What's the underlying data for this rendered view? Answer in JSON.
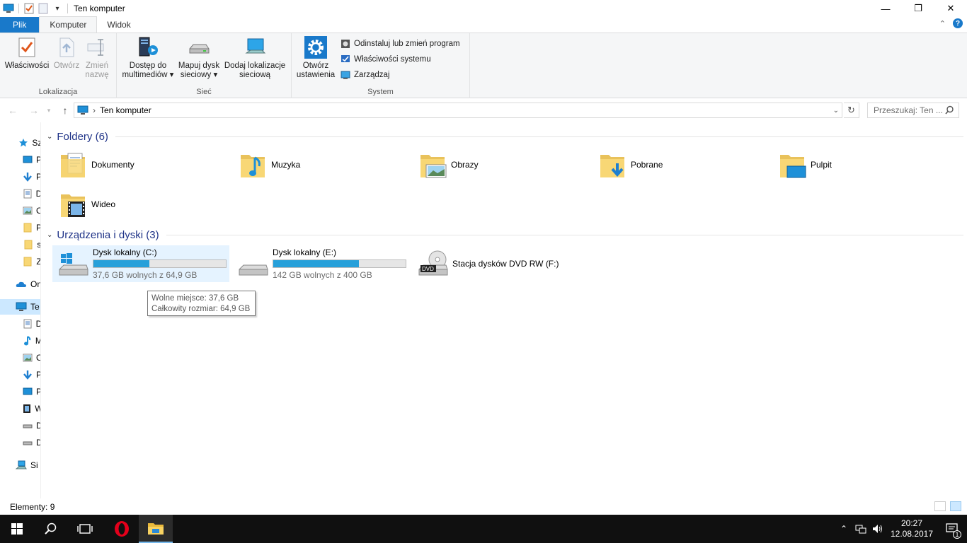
{
  "window": {
    "title": "Ten komputer",
    "minimize": "—",
    "maximize": "❐",
    "close": "✕"
  },
  "ribbon_tabs": [
    {
      "label": "Plik"
    },
    {
      "label": "Komputer"
    },
    {
      "label": "Widok"
    }
  ],
  "ribbon": {
    "location_group": {
      "label": "Lokalizacja",
      "properties": "Właściwości",
      "open": "Otwórz",
      "rename_1": "Zmień",
      "rename_2": "nazwę"
    },
    "network_group": {
      "label": "Sieć",
      "media_1": "Dostęp do",
      "media_2": "multimediów",
      "map_1": "Mapuj dysk",
      "map_2": "sieciowy",
      "add_1": "Dodaj lokalizacje",
      "add_2": "sieciową"
    },
    "system_group": {
      "label": "System",
      "settings_1": "Otwórz",
      "settings_2": "ustawienia",
      "uninstall": "Odinstaluj lub zmień program",
      "sysprops": "Właściwości systemu",
      "manage": "Zarządzaj"
    }
  },
  "address": {
    "path": "Ten komputer",
    "search_placeholder": "Przeszukaj: Ten ..."
  },
  "nav_pane": [
    {
      "icon": "star-icon",
      "label": "Sz"
    },
    {
      "icon": "desktop-icon",
      "label": "P"
    },
    {
      "icon": "download-icon",
      "label": "P"
    },
    {
      "icon": "document-icon",
      "label": "D"
    },
    {
      "icon": "pictures-icon",
      "label": "O"
    },
    {
      "icon": "folder-icon",
      "label": "P"
    },
    {
      "icon": "folder-icon",
      "label": "s"
    },
    {
      "icon": "folder-icon",
      "label": "Z"
    },
    {
      "icon": "onedrive-icon",
      "label": "On"
    },
    {
      "icon": "computer-icon",
      "label": "Te"
    },
    {
      "icon": "document-icon",
      "label": "D"
    },
    {
      "icon": "music-icon",
      "label": "M"
    },
    {
      "icon": "pictures-icon",
      "label": "O"
    },
    {
      "icon": "download-icon",
      "label": "P"
    },
    {
      "icon": "desktop-icon",
      "label": "P"
    },
    {
      "icon": "video-icon",
      "label": "W"
    },
    {
      "icon": "drive-icon",
      "label": "D"
    },
    {
      "icon": "drive-icon",
      "label": "D"
    },
    {
      "icon": "network-icon",
      "label": "Si"
    }
  ],
  "folders_section": {
    "title": "Foldery (6)",
    "items": [
      {
        "label": "Dokumenty",
        "icon": "documents-folder-icon"
      },
      {
        "label": "Muzyka",
        "icon": "music-folder-icon"
      },
      {
        "label": "Obrazy",
        "icon": "pictures-folder-icon"
      },
      {
        "label": "Pobrane",
        "icon": "downloads-folder-icon"
      },
      {
        "label": "Pulpit",
        "icon": "desktop-folder-icon"
      },
      {
        "label": "Wideo",
        "icon": "video-folder-icon"
      }
    ]
  },
  "devices_section": {
    "title": "Urządzenia i dyski (3)",
    "drives": [
      {
        "label": "Dysk lokalny (C:)",
        "free": "37,6 GB wolnych z 64,9 GB",
        "used_fraction": 0.42,
        "icon": "windows-drive-icon"
      },
      {
        "label": "Dysk lokalny (E:)",
        "free": "142 GB wolnych z 400 GB",
        "used_fraction": 0.645,
        "icon": "hard-drive-icon"
      },
      {
        "label": "Stacja dysków DVD RW (F:)",
        "icon": "dvd-drive-icon"
      }
    ]
  },
  "tooltip": {
    "line1": "Wolne miejsce: 37,6 GB",
    "line2": "Całkowity rozmiar: 64,9 GB"
  },
  "status": {
    "items": "Elementy: 9"
  },
  "taskbar": {
    "time": "20:27",
    "date": "12.08.2017",
    "notifications": "1"
  }
}
